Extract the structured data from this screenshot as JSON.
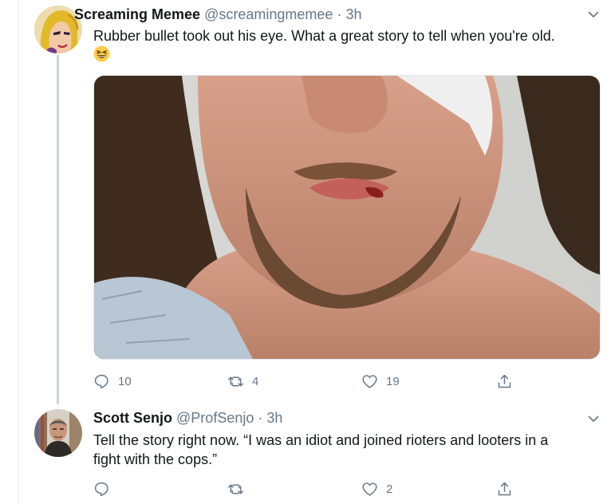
{
  "tweets": [
    {
      "display_name": "Screaming Memee",
      "handle": "@screamingmemee",
      "separator": "·",
      "time": "3h",
      "text": "Rubber bullet took out his eye. What a great story to tell when you're old.",
      "emoji": "grinning-squinting-face",
      "media": "photo",
      "replies": "10",
      "retweets": "4",
      "likes": "19"
    },
    {
      "display_name": "Scott Senjo",
      "handle": "@ProfSenjo",
      "separator": "·",
      "time": "3h",
      "text": "Tell the story right now.  “I was an idiot and joined rioters and looters in a fight with the cops.”",
      "replies": "",
      "retweets": "",
      "likes": "2"
    }
  ],
  "icons": {
    "caret": "chevron-down-icon",
    "reply": "reply-icon",
    "retweet": "retweet-icon",
    "like": "heart-icon",
    "share": "share-icon"
  },
  "colors": {
    "text": "#14171a",
    "secondary": "#657786",
    "thread_line": "#ccd6dd"
  }
}
